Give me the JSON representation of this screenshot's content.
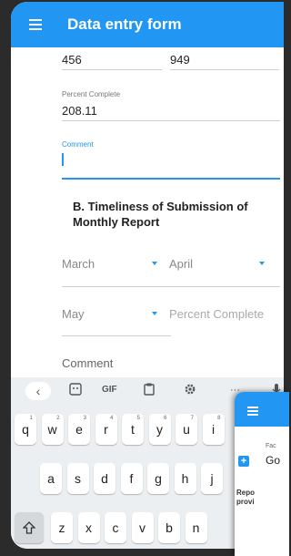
{
  "appbar": {
    "title": "Data entry form"
  },
  "form": {
    "row1_left": "456",
    "row1_right": "949",
    "percent_label": "Percent Complete",
    "percent_value": "208.11",
    "comment_label": "Comment",
    "section_title": "B. Timeliness of Submission of Monthly Report",
    "month1": "March",
    "month2": "April",
    "month3": "May",
    "percent_placeholder": "Percent Complete",
    "comment_placeholder": "Comment"
  },
  "keyboard": {
    "toolbar": {
      "back": "‹",
      "gif": "GIF",
      "more": "···"
    },
    "row1": [
      {
        "k": "q",
        "n": "1"
      },
      {
        "k": "w",
        "n": "2"
      },
      {
        "k": "e",
        "n": "3"
      },
      {
        "k": "r",
        "n": "4"
      },
      {
        "k": "t",
        "n": "5"
      },
      {
        "k": "y",
        "n": "6"
      },
      {
        "k": "u",
        "n": "7"
      },
      {
        "k": "i",
        "n": "8"
      }
    ],
    "row2": [
      "a",
      "s",
      "d",
      "f",
      "g",
      "h",
      "j"
    ],
    "row3": [
      "z",
      "x",
      "c",
      "v",
      "b",
      "n"
    ]
  },
  "overlay": {
    "fac": "Fac",
    "go": "Go",
    "rep": "Repo",
    "prov": "provi"
  },
  "colors": {
    "primary": "#2196f3"
  }
}
